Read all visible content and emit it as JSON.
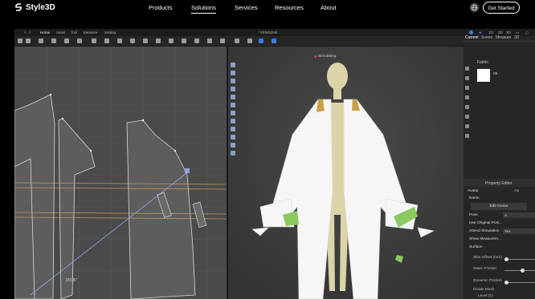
{
  "site": {
    "brand": "Style3D",
    "nav": [
      "Products",
      "Solutions",
      "Services",
      "Resources",
      "About"
    ],
    "active_nav": "Solutions",
    "cta": "Get Started"
  },
  "app": {
    "menu": [
      "Home",
      "Asset",
      "Tool",
      "Measure",
      "Setting"
    ],
    "document_title": "*YENGZHE",
    "view_modes": [
      "1D",
      "2D",
      "3D"
    ],
    "simulation_status": "Simulating",
    "measurement": "183.87"
  },
  "right_panel": {
    "tabs": [
      "Current",
      "Scene",
      "Measure",
      "3D"
    ],
    "fabric_label": "Fabric",
    "fabric_code": "06",
    "property_editor": "Property Editor",
    "section": "Avatar",
    "section_tab": "Op",
    "name_label": "Name",
    "edit_button": "Edit Avatar",
    "rows": [
      {
        "label": "Pose",
        "value": "A"
      },
      {
        "label": "Use Original Posi...",
        "value": ""
      },
      {
        "label": "Attend Simulation",
        "value": "Yes"
      },
      {
        "label": "Show Measurem...",
        "value": ""
      },
      {
        "label": "Surface",
        "value": ""
      }
    ],
    "surface_rows": [
      "Skin Offset (mm)",
      "Static Friction",
      "Dynamic Friction",
      "Divide Mesh",
      "Level (1)"
    ]
  }
}
